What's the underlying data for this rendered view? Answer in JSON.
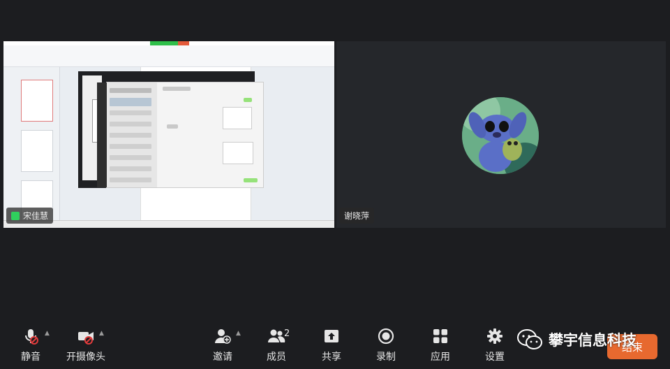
{
  "participants": {
    "left": {
      "name": "宋佳慧"
    },
    "right": {
      "name": "谢晓萍"
    }
  },
  "toolbar": {
    "mute": "静音",
    "camera": "开摄像头",
    "invite": "邀请",
    "members": "成员",
    "members_count": "2",
    "share": "共享",
    "record": "录制",
    "apps": "应用",
    "settings": "设置",
    "end": "结束"
  },
  "watermark": {
    "text": "攀宇信息科技"
  },
  "colors": {
    "end": "#e7692f",
    "mic_active": "#2fd15d",
    "muted_red": "#e23c3c"
  }
}
